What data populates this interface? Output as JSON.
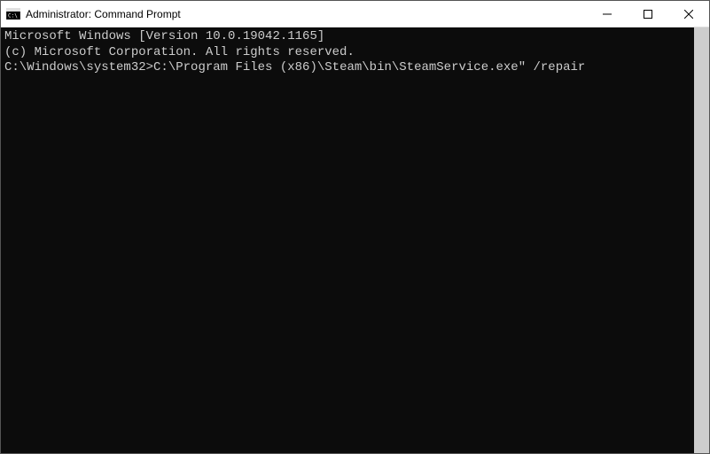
{
  "window": {
    "title": "Administrator: Command Prompt"
  },
  "terminal": {
    "line1": "Microsoft Windows [Version 10.0.19042.1165]",
    "line2": "(c) Microsoft Corporation. All rights reserved.",
    "blank1": "",
    "prompt": "C:\\Windows\\system32>",
    "command": "C:\\Program Files (x86)\\Steam\\bin\\SteamService.exe\" /repair"
  }
}
